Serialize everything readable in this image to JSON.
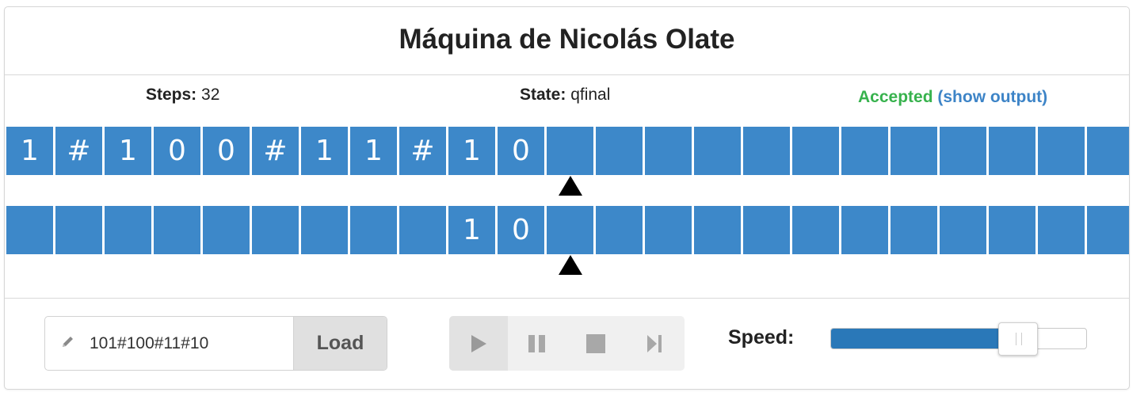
{
  "title": "Máquina de Nicolás Olate",
  "status_bar": {
    "steps_label": "Steps:",
    "steps_value": "32",
    "state_label": "State:",
    "state_value": "qfinal",
    "result": "Accepted",
    "show_output": "(show output)"
  },
  "tapes": [
    {
      "cells": [
        "1",
        "#",
        "1",
        "0",
        "0",
        "#",
        "1",
        "1",
        "#",
        "1",
        "0",
        "",
        "",
        "",
        "",
        "",
        "",
        "",
        "",
        "",
        "",
        "",
        "",
        ""
      ],
      "head_index": 11
    },
    {
      "cells": [
        "",
        "",
        "",
        "",
        "",
        "",
        "",
        "",
        "",
        "1",
        "0",
        "",
        "",
        "",
        "",
        "",
        "",
        "",
        "",
        "",
        "",
        "",
        "",
        ""
      ],
      "head_index": 11
    }
  ],
  "input": {
    "icon": "pencil-icon",
    "value": "101#100#11#10",
    "load_label": "Load"
  },
  "player": {
    "buttons": [
      "play-icon",
      "pause-icon",
      "stop-icon",
      "step-icon"
    ],
    "active": "play-icon"
  },
  "speed": {
    "label": "Speed:",
    "value": 0.77
  },
  "colors": {
    "cell": "#3d88c9",
    "accepted": "#37b24d",
    "link": "#3d84c7",
    "slider_fill": "#2a78b8"
  }
}
